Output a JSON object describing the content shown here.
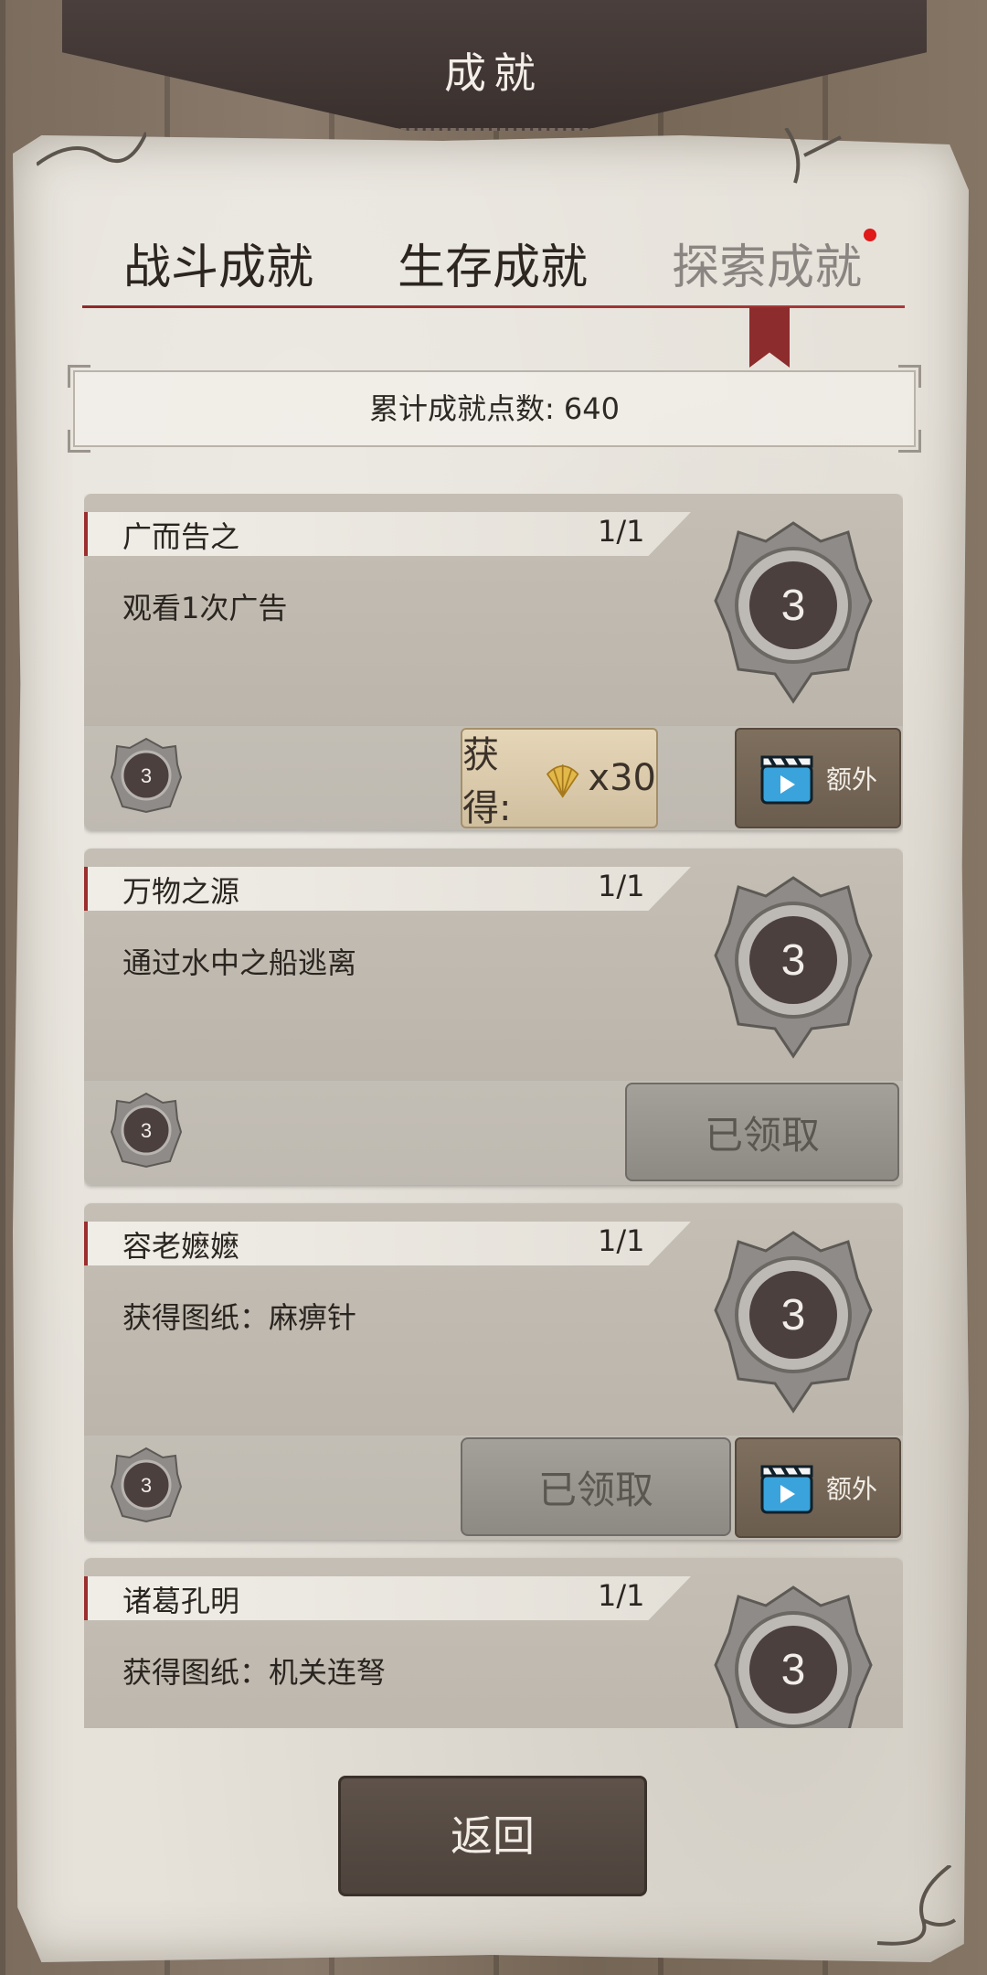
{
  "header": {
    "title": "成就"
  },
  "tabs": [
    {
      "label": "战斗成就",
      "active": false
    },
    {
      "label": "生存成就",
      "active": false
    },
    {
      "label": "探索成就",
      "active": true,
      "has_red_dot": true
    }
  ],
  "points": {
    "label": "累计成就点数: 640"
  },
  "achievements": [
    {
      "name": "广而告之",
      "progress": "1/1",
      "description": "观看1次广告",
      "medal_value": "3",
      "small_medal_value": "3",
      "reward_label": "获得:",
      "reward_amount": "x30",
      "reward_icon": "shell-icon",
      "extra_label": "额外"
    },
    {
      "name": "万物之源",
      "progress": "1/1",
      "description": "通过水中之船逃离",
      "medal_value": "3",
      "small_medal_value": "3",
      "status_label": "已领取"
    },
    {
      "name": "容老嬷嬷",
      "progress": "1/1",
      "description": "获得图纸：麻痹针",
      "medal_value": "3",
      "small_medal_value": "3",
      "status_label": "已领取",
      "extra_label": "额外"
    },
    {
      "name": "诸葛孔明",
      "progress": "1/1",
      "description": "获得图纸：机关连弩",
      "medal_value": "3"
    }
  ],
  "footer": {
    "return_label": "返回"
  },
  "colors": {
    "accent_red": "#9b2e2e",
    "red_dot": "#e01919",
    "paper": "#e6e2da",
    "card": "#bdb7ad"
  }
}
